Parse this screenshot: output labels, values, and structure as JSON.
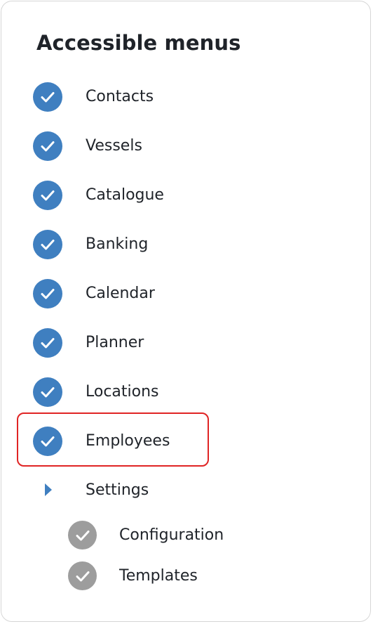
{
  "panel": {
    "title": "Accessible menus",
    "items": [
      {
        "label": "Contacts",
        "checked": true,
        "icon": "check-circle-icon"
      },
      {
        "label": "Vessels",
        "checked": true,
        "icon": "check-circle-icon"
      },
      {
        "label": "Catalogue",
        "checked": true,
        "icon": "check-circle-icon"
      },
      {
        "label": "Banking",
        "checked": true,
        "icon": "check-circle-icon"
      },
      {
        "label": "Calendar",
        "checked": true,
        "icon": "check-circle-icon"
      },
      {
        "label": "Planner",
        "checked": true,
        "icon": "check-circle-icon"
      },
      {
        "label": "Locations",
        "checked": true,
        "icon": "check-circle-icon"
      },
      {
        "label": "Employees",
        "checked": true,
        "icon": "check-circle-icon",
        "highlighted": true
      }
    ],
    "settings": {
      "label": "Settings",
      "icon": "caret-right-icon",
      "expanded": true,
      "sub_items": [
        {
          "label": "Configuration",
          "checked": true,
          "disabled": true,
          "icon": "check-circle-icon"
        },
        {
          "label": "Templates",
          "checked": true,
          "disabled": true,
          "icon": "check-circle-icon"
        }
      ]
    }
  },
  "colors": {
    "check_active": "#3f7fc0",
    "check_disabled": "#9d9d9d",
    "highlight_border": "#e02424",
    "text": "#1f2329"
  }
}
